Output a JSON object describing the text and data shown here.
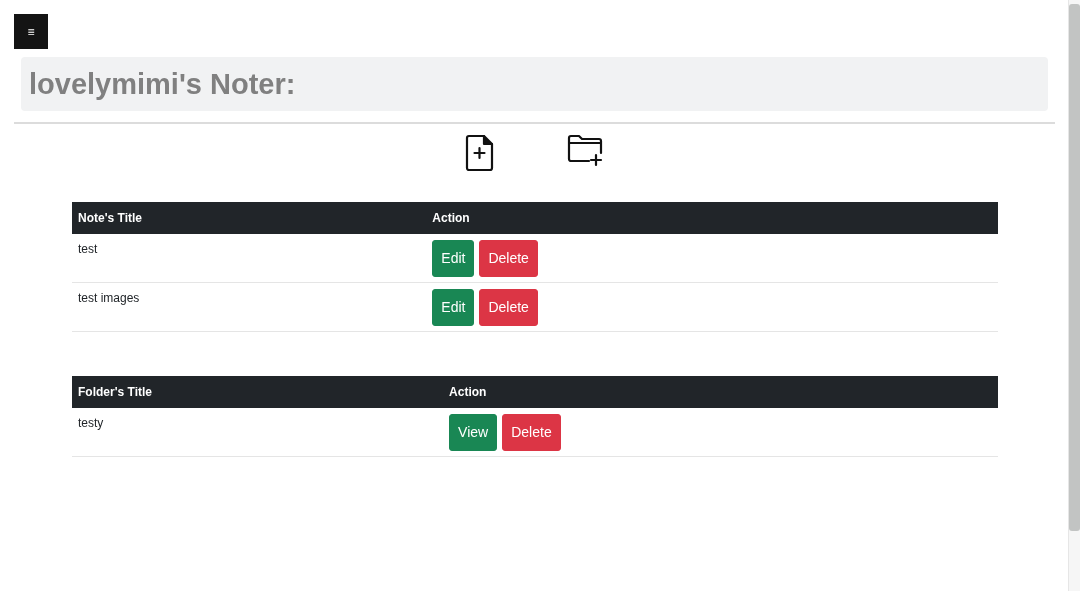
{
  "menu_button": {
    "label": "≡"
  },
  "header": {
    "title": "lovelymimi's Noter:"
  },
  "toolbar": [
    {
      "kind": "new-note"
    },
    {
      "kind": "new-folder"
    }
  ],
  "notes_table": {
    "columns": [
      "Note's Title",
      "Action"
    ],
    "rows": [
      {
        "title": "test",
        "buttons": [
          {
            "label": "Edit",
            "kind": "success"
          },
          {
            "label": "Delete",
            "kind": "danger"
          }
        ]
      },
      {
        "title": "test images",
        "buttons": [
          {
            "label": "Edit",
            "kind": "success"
          },
          {
            "label": "Delete",
            "kind": "danger"
          }
        ]
      }
    ]
  },
  "folders_table": {
    "columns": [
      "Folder's Title",
      "Action"
    ],
    "rows": [
      {
        "title": "testy",
        "buttons": [
          {
            "label": "View",
            "kind": "success"
          },
          {
            "label": "Delete",
            "kind": "danger"
          }
        ]
      }
    ]
  }
}
